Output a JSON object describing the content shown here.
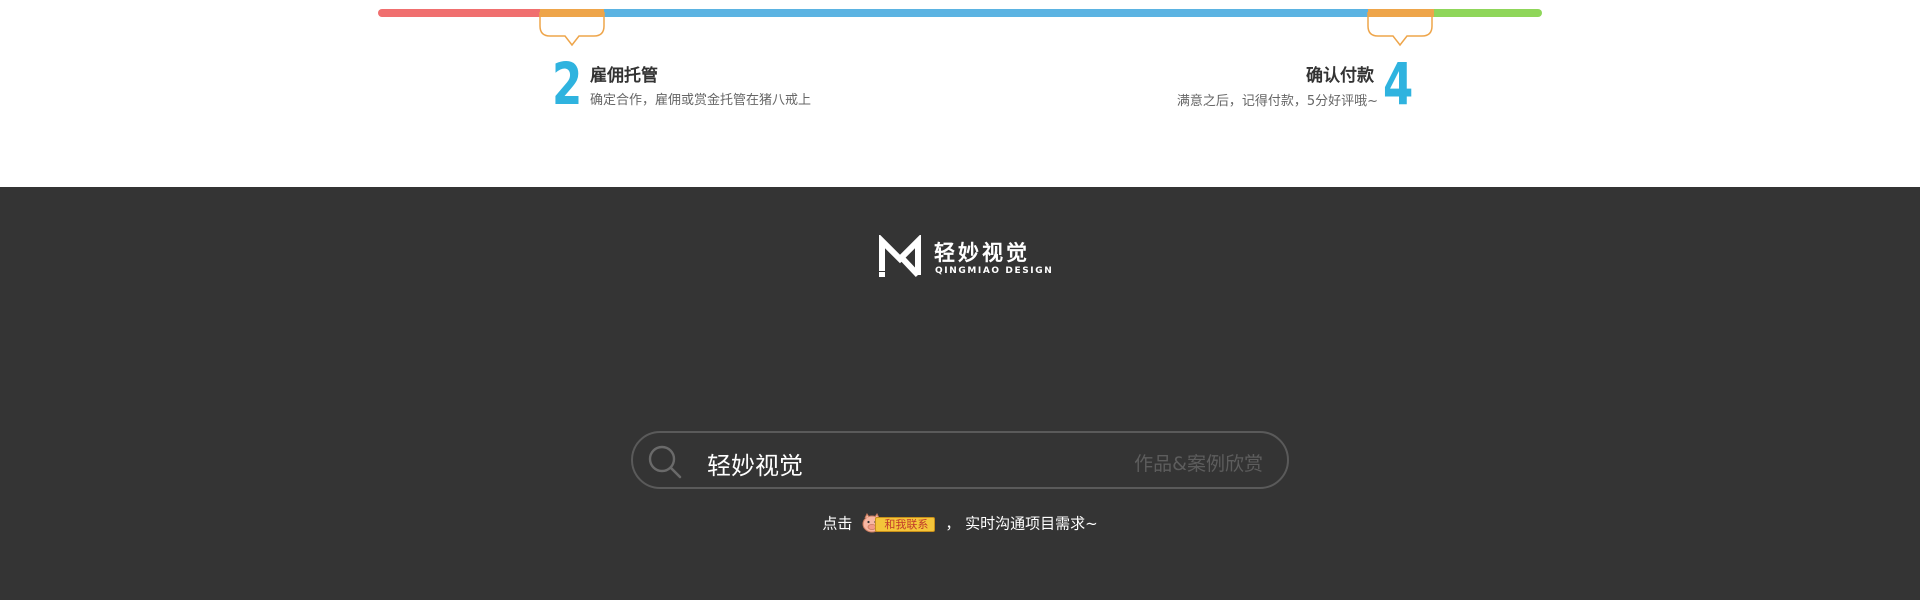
{
  "process": {
    "colors": {
      "red": "#f06f6f",
      "orange": "#eea54a",
      "blue": "#5bb3e2",
      "green": "#8fd65a",
      "step_number": "#2fb3df"
    },
    "step2": {
      "number": "2",
      "title": "雇佣托管",
      "desc": "确定合作，雇佣或赏金托管在猪八戒上"
    },
    "step4": {
      "number": "4",
      "title": "确认付款",
      "desc": "满意之后，记得付款，5分好评哦~"
    }
  },
  "footer": {
    "background": "#343434",
    "logo": {
      "cn": "轻妙视觉",
      "en": "QINGMIAO DESIGN"
    },
    "search": {
      "icon": "search-icon",
      "value": "轻妙视觉",
      "hint": "作品&案例欣赏"
    },
    "contact": {
      "prefix": "点击",
      "badge_label": "和我联系",
      "suffix": "，  实时沟通项目需求~"
    }
  }
}
